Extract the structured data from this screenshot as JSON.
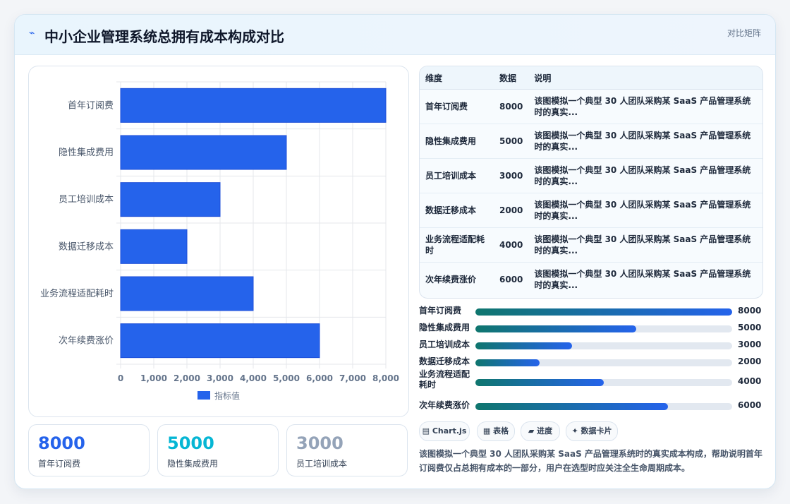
{
  "header": {
    "icon": "chart-line-icon",
    "title": "中小企业管理系统总拥有成本构成对比",
    "right_label": "对比矩阵"
  },
  "chart_data": {
    "type": "bar",
    "orientation": "horizontal",
    "categories": [
      "首年订阅费",
      "隐性集成费用",
      "员工培训成本",
      "数据迁移成本",
      "业务流程适配耗时",
      "次年续费涨价"
    ],
    "series": [
      {
        "name": "指标值",
        "values": [
          8000,
          5000,
          3000,
          2000,
          4000,
          6000
        ],
        "color": "#2563eb"
      }
    ],
    "xlim": [
      0,
      8000
    ],
    "xticks": [
      "0",
      "1,000",
      "2,000",
      "3,000",
      "4,000",
      "5,000",
      "6,000",
      "7,000",
      "8,000"
    ],
    "grid": true,
    "legend": "bottom"
  },
  "stats": [
    {
      "value": "8000",
      "label": "首年订阅费",
      "color": "#2563eb"
    },
    {
      "value": "5000",
      "label": "隐性集成费用",
      "color": "#06b6d4"
    },
    {
      "value": "3000",
      "label": "员工培训成本",
      "color": "#94a3b8"
    }
  ],
  "table": {
    "headers": [
      "维度",
      "数据",
      "说明"
    ],
    "rows": [
      [
        "首年订阅费",
        "8000",
        "该图模拟一个典型 30 人团队采购某 SaaS 产品管理系统时的真实..."
      ],
      [
        "隐性集成费用",
        "5000",
        "该图模拟一个典型 30 人团队采购某 SaaS 产品管理系统时的真实..."
      ],
      [
        "员工培训成本",
        "3000",
        "该图模拟一个典型 30 人团队采购某 SaaS 产品管理系统时的真实..."
      ],
      [
        "数据迁移成本",
        "2000",
        "该图模拟一个典型 30 人团队采购某 SaaS 产品管理系统时的真实..."
      ],
      [
        "业务流程适配耗时",
        "4000",
        "该图模拟一个典型 30 人团队采购某 SaaS 产品管理系统时的真实..."
      ],
      [
        "次年续费涨价",
        "6000",
        "该图模拟一个典型 30 人团队采购某 SaaS 产品管理系统时的真实..."
      ]
    ]
  },
  "progress": [
    {
      "label": "首年订阅费",
      "value": "8000",
      "fraction": 1.0
    },
    {
      "label": "隐性集成费用",
      "value": "5000",
      "fraction": 0.625
    },
    {
      "label": "员工培训成本",
      "value": "3000",
      "fraction": 0.375
    },
    {
      "label": "数据迁移成本",
      "value": "2000",
      "fraction": 0.25
    },
    {
      "label": "业务流程适配耗时",
      "value": "4000",
      "fraction": 0.5
    },
    {
      "label": "次年续费涨价",
      "value": "6000",
      "fraction": 0.75
    }
  ],
  "tags": [
    {
      "icon": "chart-icon",
      "glyph": "▤",
      "label": "Chart.js"
    },
    {
      "icon": "table-icon",
      "glyph": "▦",
      "label": "表格"
    },
    {
      "icon": "progress-icon",
      "glyph": "▰",
      "label": "进度"
    },
    {
      "icon": "card-icon",
      "glyph": "✦",
      "label": "数据卡片"
    }
  ],
  "description": "该图模拟一个典型 30 人团队采购某 SaaS 产品管理系统时的真实成本构成，帮助说明首年订阅费仅占总拥有成本的一部分，用户在选型时应关注全生命周期成本。"
}
